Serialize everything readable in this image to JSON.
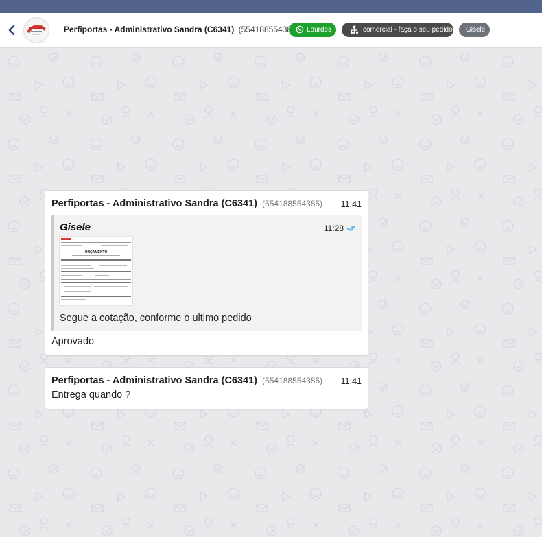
{
  "header": {
    "title": "Perfiportas - Administrativo Sandra (C6341)",
    "phone": "(554188554385)",
    "tags": {
      "agent": "Lourdes",
      "queue": "comercial - faça o seu pedido",
      "user": "Gisele"
    }
  },
  "messages": [
    {
      "sender": "Perfiportas - Administrativo Sandra (C6341)",
      "phone": "(554188554385)",
      "time": "11:41",
      "quoted": {
        "author": "Gisele",
        "time": "11:28",
        "attachment_title": "ORÇAMENTO",
        "text": "Segue a cotação, conforme o ultimo pedido"
      },
      "text": "Aprovado"
    },
    {
      "sender": "Perfiportas - Administrativo Sandra (C6341)",
      "phone": "(554188554385)",
      "time": "11:41",
      "text": "Entrega quando ?"
    }
  ],
  "colors": {
    "topbar": "#52648b",
    "agent_tag": "#1fa12e",
    "queue_tag": "#4a4a4a",
    "user_tag": "#6d7279",
    "read_check": "#4aa8e0"
  }
}
